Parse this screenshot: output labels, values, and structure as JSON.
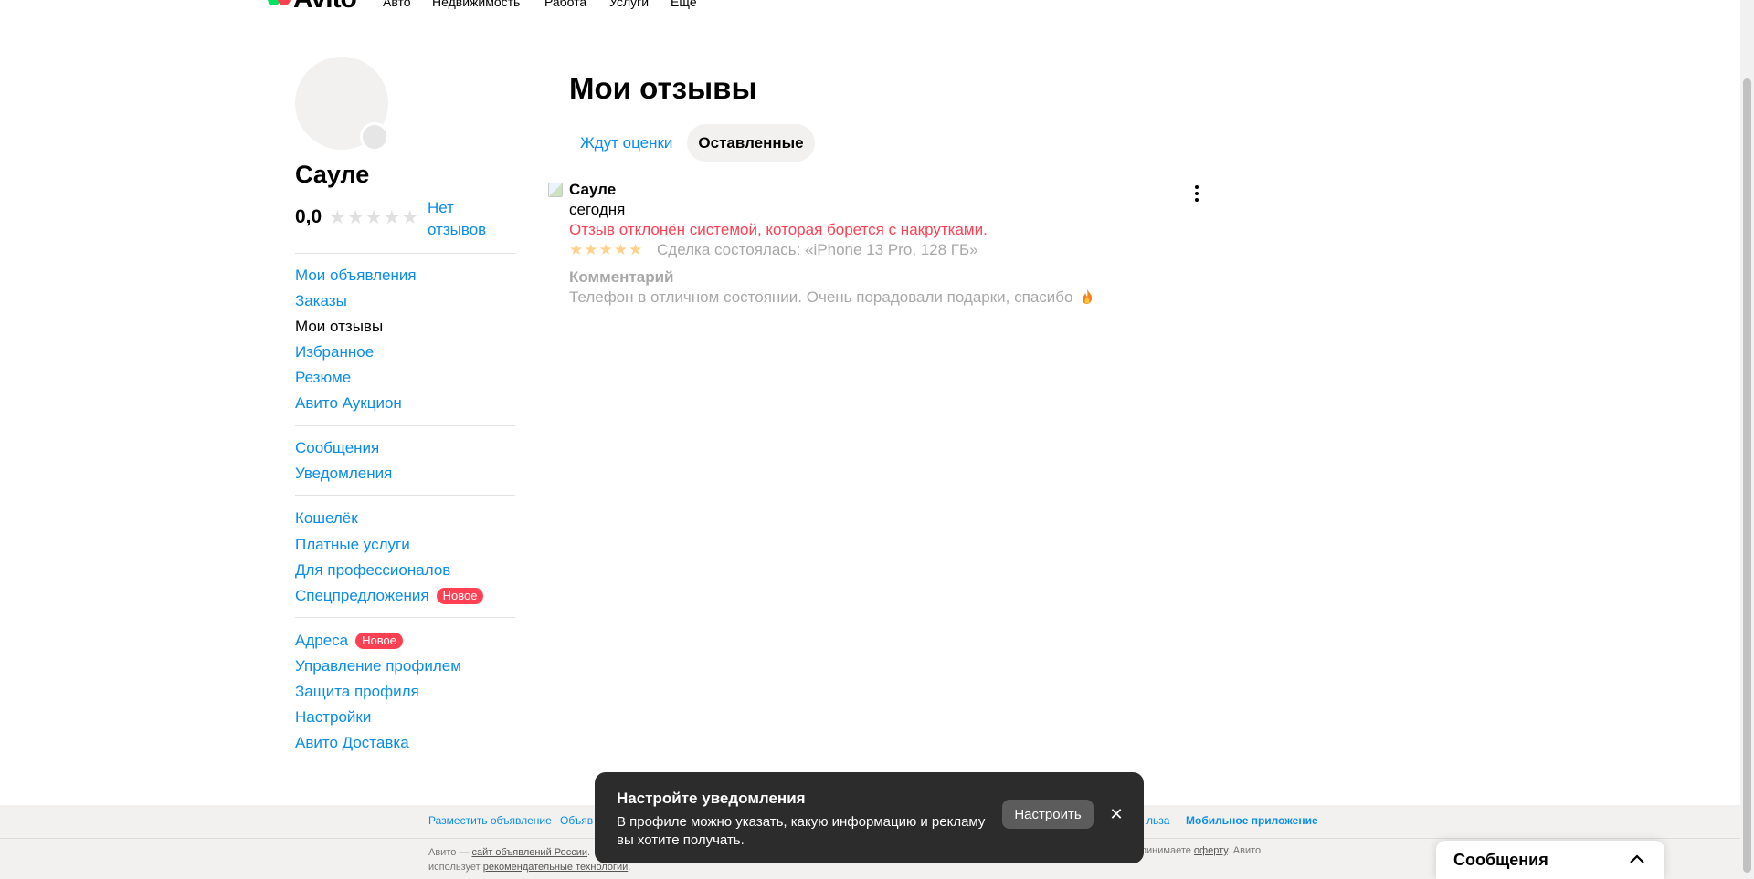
{
  "header": {
    "logo_text": "Avito",
    "nav": [
      "Авто",
      "Недвижимость",
      "Работа",
      "Услуги",
      "Ещё"
    ]
  },
  "profile": {
    "name": "Сауле",
    "rating": "0,0",
    "stars": "★★★★★",
    "no_reviews": "Нет отзывов"
  },
  "sidebar": {
    "groups": [
      [
        "Мои объявления",
        "Заказы",
        "Мои отзывы",
        "Избранное",
        "Резюме",
        "Авито Аукцион"
      ],
      [
        "Сообщения",
        "Уведомления"
      ],
      [
        "Кошелёк",
        "Платные услуги",
        "Для профессионалов",
        "Спецпредложения"
      ],
      [
        "Адреса",
        "Управление профилем",
        "Защита профиля",
        "Настройки",
        "Авито Доставка"
      ]
    ],
    "badge_new": "Новое"
  },
  "main": {
    "title": "Мои отзывы",
    "tabs": [
      "Ждут оценки",
      "Оставленные"
    ],
    "review": {
      "reviewer": "Сауле",
      "date": "сегодня",
      "status": "Отзыв отклонён системой, которая борется с накрутками.",
      "stars": "★★★★★",
      "deal": "Сделка состоялась: «iPhone 13 Pro, 128 ГБ»",
      "comment_label": "Комментарий",
      "comment": "Телефон в отличном состоянии. Очень порадовали подарки, спасибо"
    }
  },
  "footer": {
    "links": [
      "Разместить объявление",
      "Объяв",
      "льза",
      "Мобильное приложение"
    ],
    "legal_prefix": "Авито — ",
    "legal_link1": "сайт объявлений России",
    "legal_line1_end": ".",
    "legal_line2_prefix": "использует ",
    "legal_link2": "рекомендательные технологии",
    "legal_line2_end": ".",
    "legal_right_prefix": "ы принимаете ",
    "legal_right_link": "оферту",
    "legal_right_end": ". Авито"
  },
  "toast": {
    "title": "Настройте уведомления",
    "text": "В профиле можно указать, какую информацию и рекламу вы хотите получать.",
    "button": "Настроить",
    "close": "✕"
  },
  "messenger": {
    "title": "Сообщения"
  },
  "colors": {
    "link": "#0a8ce8",
    "error": "#ff4053",
    "toast_bg": "#2c2c2c",
    "star_inactive": "#e0e0e0",
    "star_pending": "#ffd18a"
  }
}
